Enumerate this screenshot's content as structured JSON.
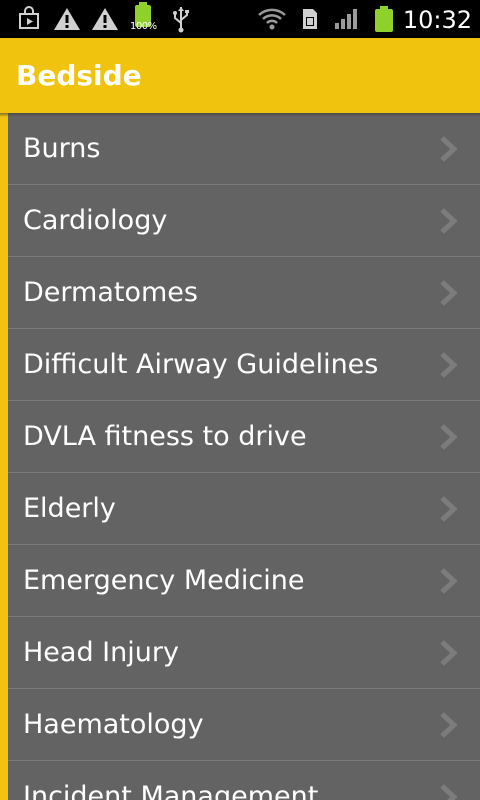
{
  "status_bar": {
    "time": "10:32",
    "battery_percent_text": "100%",
    "icons": [
      "play-store-icon",
      "warning-icon",
      "warning-icon",
      "battery-small-icon",
      "usb-icon",
      "wifi-icon",
      "sim-icon",
      "signal-icon",
      "battery-icon"
    ]
  },
  "app_bar": {
    "title": "Bedside"
  },
  "colors": {
    "accent": "#f0c30f",
    "list_background": "#636363",
    "divider": "#7a7a7a",
    "text": "#ffffff"
  },
  "list": {
    "items": [
      {
        "label": "Burns"
      },
      {
        "label": "Cardiology"
      },
      {
        "label": "Dermatomes"
      },
      {
        "label": "Difficult Airway Guidelines"
      },
      {
        "label": "DVLA fitness to drive"
      },
      {
        "label": "Elderly"
      },
      {
        "label": "Emergency Medicine"
      },
      {
        "label": "Head Injury"
      },
      {
        "label": "Haematology"
      },
      {
        "label": "Incident Management"
      }
    ],
    "item_icon": "chevron-right-icon"
  }
}
